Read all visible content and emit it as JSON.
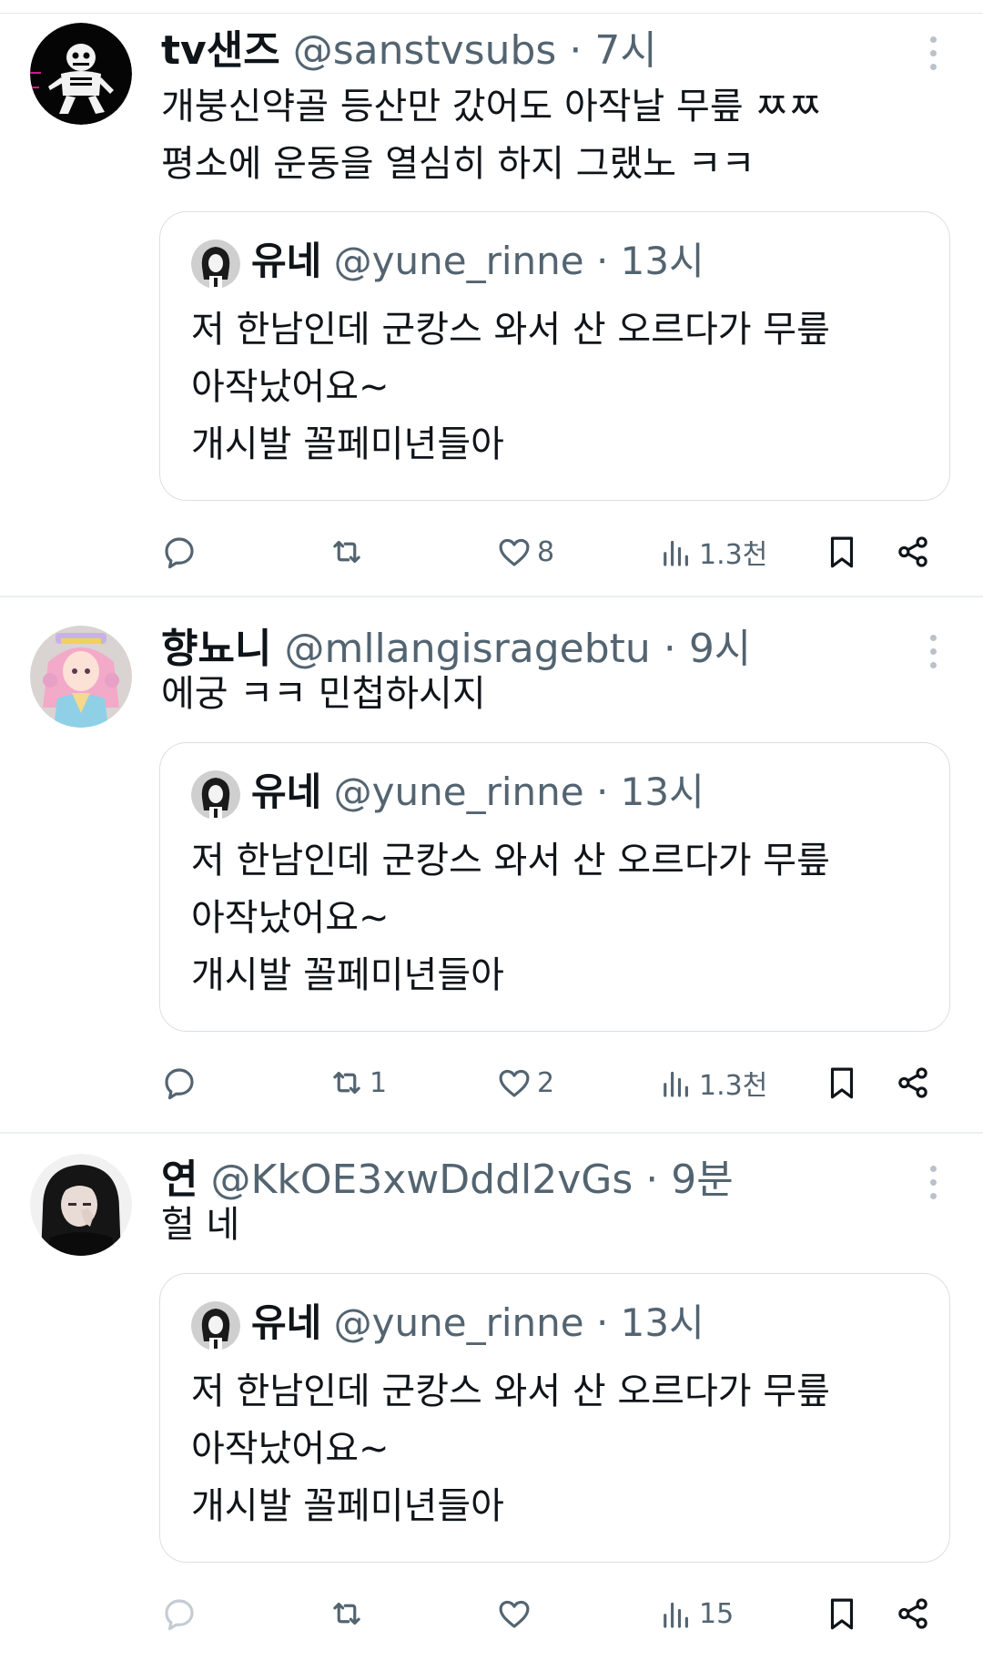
{
  "quoted_tweet": {
    "name": "유네",
    "handle": "@yune_rinne",
    "time": "13시",
    "lines": [
      "저 한남인데 군캉스 와서 산 오르다가 무릎",
      "아작났어요~",
      "개시발 꼴페미년들아"
    ]
  },
  "tweets": [
    {
      "name": "tv샌즈",
      "handle": "@sanstvsubs",
      "time": "7시",
      "lines": [
        "개붕신약골 등산만 갔어도 아작날 무릎 ㅉㅉ",
        "평소에 운동을 열심히 하지 그랬노 ㅋㅋ"
      ],
      "retweets": "",
      "likes": "8",
      "views": "1.3천"
    },
    {
      "name": "향뇨니",
      "handle": "@mllangisragebtu",
      "time": "9시",
      "lines": [
        "에궁 ㅋㅋ 민첩하시지"
      ],
      "retweets": "1",
      "likes": "2",
      "views": "1.3천"
    },
    {
      "name": "연",
      "handle": "@KkOE3xwDddl2vGs",
      "time": "9분",
      "lines": [
        "헐 네"
      ],
      "retweets": "",
      "likes": "",
      "views": "15"
    }
  ],
  "separator": "·",
  "icons": {
    "reply": "speech-bubble-icon",
    "retweet": "retweet-arrows-icon",
    "like": "heart-icon",
    "views": "bar-chart-icon",
    "bookmark": "bookmark-icon",
    "share": "share-icon",
    "more": "vertical-dots-icon"
  }
}
